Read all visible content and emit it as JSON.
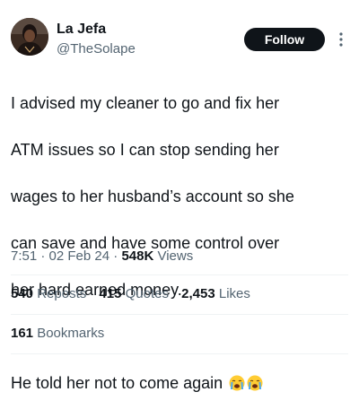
{
  "author": {
    "display_name": "La Jefa",
    "handle": "@TheSolape",
    "avatar_icon": "profile-photo"
  },
  "follow_button": {
    "label": "Follow"
  },
  "more_icon": "more-vertical-icon",
  "tweet": {
    "lines": [
      "I advised my cleaner to go and fix her",
      "ATM issues so I can stop sending her",
      "wages to her husband’s account so she",
      "can save and have some control over",
      "her hard earned money.",
      "",
      "He told her not to come again"
    ],
    "emoji": [
      "loudly-crying-face",
      "loudly-crying-face"
    ]
  },
  "meta": {
    "time": "7:51",
    "separator": "·",
    "date": "02 Feb 24",
    "views_count": "548K",
    "views_label": "Views"
  },
  "stats": {
    "reposts": {
      "count": "540",
      "label": "Reposts"
    },
    "quotes": {
      "count": "415",
      "label": "Quotes"
    },
    "likes": {
      "count": "2,453",
      "label": "Likes"
    },
    "bookmarks": {
      "count": "161",
      "label": "Bookmarks"
    }
  },
  "colors": {
    "text_primary": "#0f1419",
    "text_secondary": "#536471",
    "follow_bg": "#0f1419",
    "divider": "#eff3f4"
  }
}
